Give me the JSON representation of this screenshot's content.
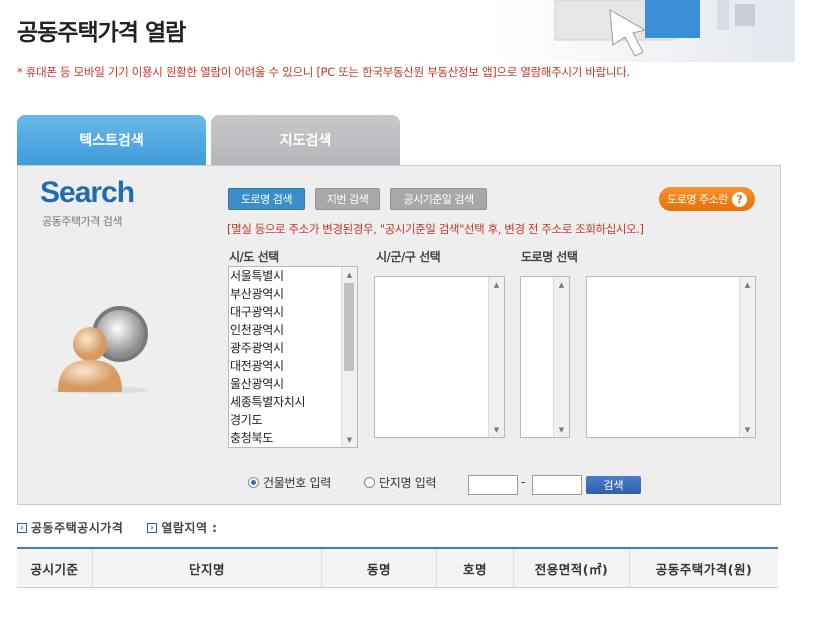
{
  "page": {
    "title": "공동주택가격 열람",
    "notice": "* 휴대폰 등 모바일 기기 이용시 원활한 열람이 어려울 수 있으니 [PC 또는 한국부동산원 부동산정보 앱]으로 열람해주시기 바랍니다."
  },
  "tabs": {
    "text_search": "텍스트검색",
    "map_search": "지도검색"
  },
  "panel": {
    "logo_title": "Search",
    "logo_subtitle": "공동주택가격 검색",
    "buttons": {
      "road": "도로명 검색",
      "jibun": "지번 검색",
      "date": "공시기준일 검색",
      "road_help": "도로명 주소란"
    },
    "help_icon": "?",
    "warning": "[멸실 등으로 주소가 변경된경우, \"공시기준일 검색\"선택 후, 변경 전 주소로 조회하십시오.]",
    "labels": {
      "sido": "시/도 선택",
      "sigungu": "시/군/구 선택",
      "road_name": "도로명 선택"
    },
    "sido_options": [
      "서울특별시",
      "부산광역시",
      "대구광역시",
      "인천광역시",
      "광주광역시",
      "대전광역시",
      "울산광역시",
      "세종특별자치시",
      "경기도",
      "충청북도"
    ],
    "radio": {
      "building_no": "건물번호 입력",
      "complex_name": "단지명 입력",
      "selected": "building_no"
    },
    "dash": "-",
    "search_button": "검색"
  },
  "info": {
    "price_label": "공동주택공시가격",
    "region_label": "열람지역 :"
  },
  "table": {
    "headers": [
      "공시기준",
      "단지명",
      "동명",
      "호명",
      "전용면적(㎡)",
      "공동주택가격(원)"
    ]
  },
  "colors": {
    "accent": "#3b8ec7",
    "warning": "#c0392b",
    "orange": "#f7922a"
  }
}
